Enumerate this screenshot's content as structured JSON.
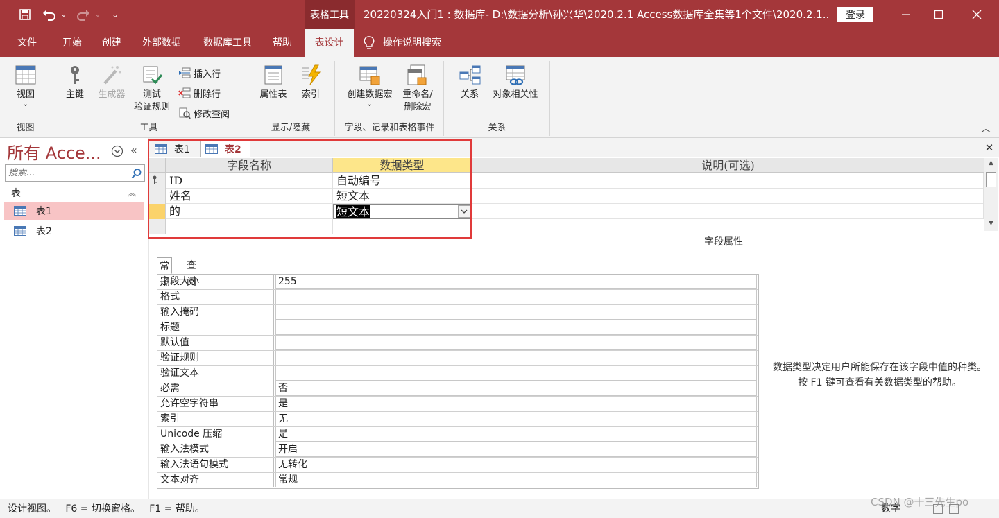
{
  "titlebar": {
    "context_tab": "表格工具",
    "title": "20220324入门1 : 数据库- D:\\数据分析\\孙兴华\\2020.2.1 Access数据库全集等1个文件\\2020.2.1...",
    "login": "登录",
    "qa_save_icon": "save-icon",
    "qa_undo_icon": "undo-icon",
    "qa_redo_icon": "redo-icon"
  },
  "menu": {
    "tabs": [
      "文件",
      "开始",
      "创建",
      "外部数据",
      "数据库工具",
      "帮助",
      "表设计"
    ],
    "active": "表设计",
    "tell_me": "操作说明搜索"
  },
  "ribbon": {
    "view_group": {
      "label": "视图",
      "view_btn": "视图"
    },
    "tools_group": {
      "label": "工具",
      "primary_key": "主键",
      "builder": "生成器",
      "test_rules_1": "测试",
      "test_rules_2": "验证规则",
      "insert_row": "插入行",
      "delete_row": "删除行",
      "modify_lookup": "修改查阅"
    },
    "show_hide_group": {
      "label": "显示/隐藏",
      "property_sheet": "属性表",
      "indexes": "索引"
    },
    "events_group": {
      "label": "字段、记录和表格事件",
      "create_macro": "创建数据宏",
      "rename_macro_1": "重命名/",
      "rename_macro_2": "删除宏"
    },
    "relations_group": {
      "label": "关系",
      "relationships": "关系",
      "dependencies": "对象相关性"
    }
  },
  "nav": {
    "title": "所有 Acce...",
    "search_placeholder": "搜索...",
    "section": "表",
    "items": [
      "表1",
      "表2"
    ],
    "selected": "表1"
  },
  "doc_tabs": [
    "表1",
    "表2"
  ],
  "active_doc_tab": "表2",
  "design_grid": {
    "headers": [
      "字段名称",
      "数据类型",
      "说明(可选)"
    ],
    "rows": [
      {
        "name": "ID",
        "type": "自动编号",
        "primary_key": true
      },
      {
        "name": "姓名",
        "type": "短文本"
      },
      {
        "name": "的",
        "type": "短文本",
        "editing": true
      }
    ]
  },
  "field_properties": {
    "title": "字段属性",
    "tabs": [
      "常规",
      "查阅"
    ],
    "active_tab": "常规",
    "rows": [
      {
        "name": "字段大小",
        "value": "255"
      },
      {
        "name": "格式",
        "value": ""
      },
      {
        "name": "输入掩码",
        "value": ""
      },
      {
        "name": "标题",
        "value": ""
      },
      {
        "name": "默认值",
        "value": ""
      },
      {
        "name": "验证规则",
        "value": ""
      },
      {
        "name": "验证文本",
        "value": ""
      },
      {
        "name": "必需",
        "value": "否"
      },
      {
        "name": "允许空字符串",
        "value": "是"
      },
      {
        "name": "索引",
        "value": "无"
      },
      {
        "name": "Unicode 压缩",
        "value": "是"
      },
      {
        "name": "输入法模式",
        "value": "开启"
      },
      {
        "name": "输入法语句模式",
        "value": "无转化"
      },
      {
        "name": "文本对齐",
        "value": "常规"
      }
    ],
    "help": "数据类型决定用户所能保存在该字段中值的种类。按 F1 键可查看有关数据类型的帮助。"
  },
  "status": {
    "left": "设计视图。   F6 = 切换窗格。   F1 = 帮助。",
    "right": "数字"
  },
  "watermark": "CSDN @十三先生po",
  "colors": {
    "accent": "#a4373a",
    "highlight_box": "#e03a3a",
    "selected_nav": "#f8c4c5",
    "active_header": "#fde68a"
  }
}
